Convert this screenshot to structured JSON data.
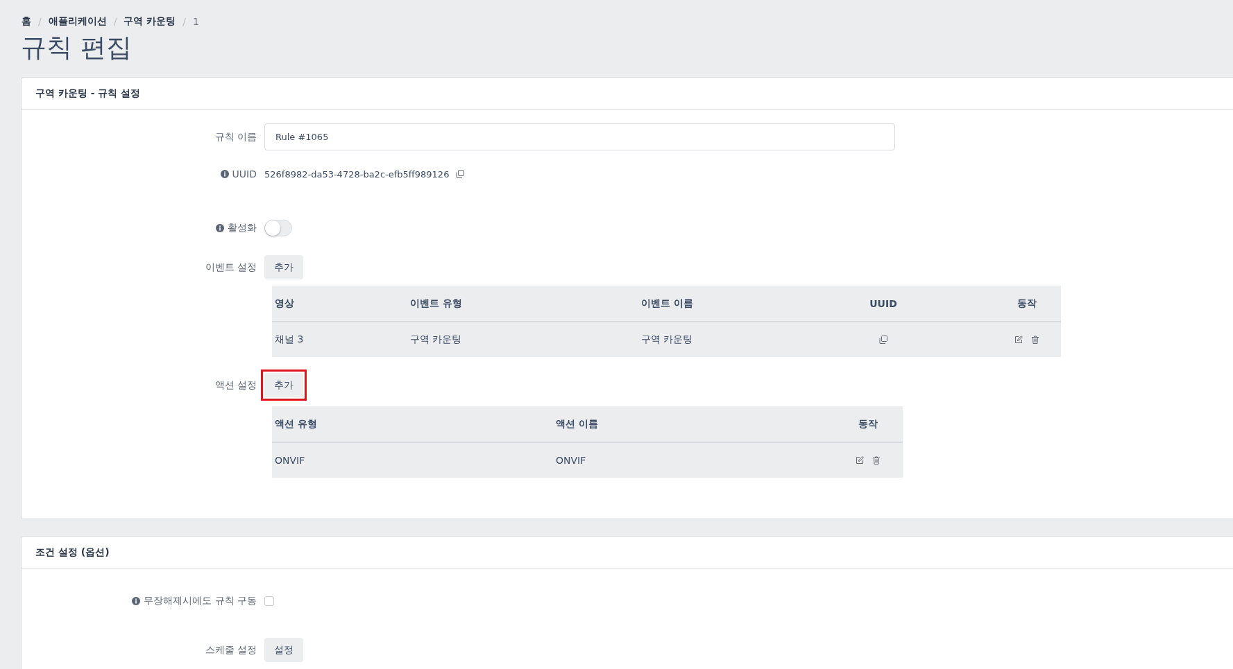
{
  "breadcrumb": [
    {
      "label": "홈",
      "current": false
    },
    {
      "label": "애플리케이션",
      "current": false
    },
    {
      "label": "구역 카운팅",
      "current": false
    },
    {
      "label": "1",
      "current": true
    }
  ],
  "breadcrumb_separators": [
    "/",
    "/",
    "/"
  ],
  "page_title": "규칙 편집",
  "rule_card": {
    "title": "구역 카운팅 - 규칙 설정",
    "name_field": {
      "label": "규칙 이름",
      "value": "Rule #1065"
    },
    "uuid": {
      "label": "UUID",
      "value": "526f8982-da53-4728-ba2c-efb5ff989126"
    },
    "enable": {
      "label": "활성화",
      "on": false
    },
    "events": {
      "label": "이벤트 설정",
      "button": "추가",
      "columns": [
        "영상",
        "이벤트 유형",
        "이벤트 이름",
        "UUID",
        "동작"
      ],
      "rows": [
        {
          "video": "채널 3",
          "event_type": "구역 카운팅",
          "event_name": "구역 카운팅"
        }
      ]
    },
    "actions": {
      "label": "액션 설정",
      "button": "추가",
      "highlighted": true,
      "columns": [
        "액션 유형",
        "액션 이름",
        "동작"
      ],
      "rows": [
        {
          "action_type": "ONVIF",
          "action_name": "ONVIF"
        }
      ]
    }
  },
  "condition_card": {
    "title": "조건 설정 (옵션)",
    "disarm": {
      "label": "무장해제시에도 규칙 구동",
      "checked": false
    },
    "schedule": {
      "label": "스케줄 설정",
      "button": "설정"
    }
  }
}
